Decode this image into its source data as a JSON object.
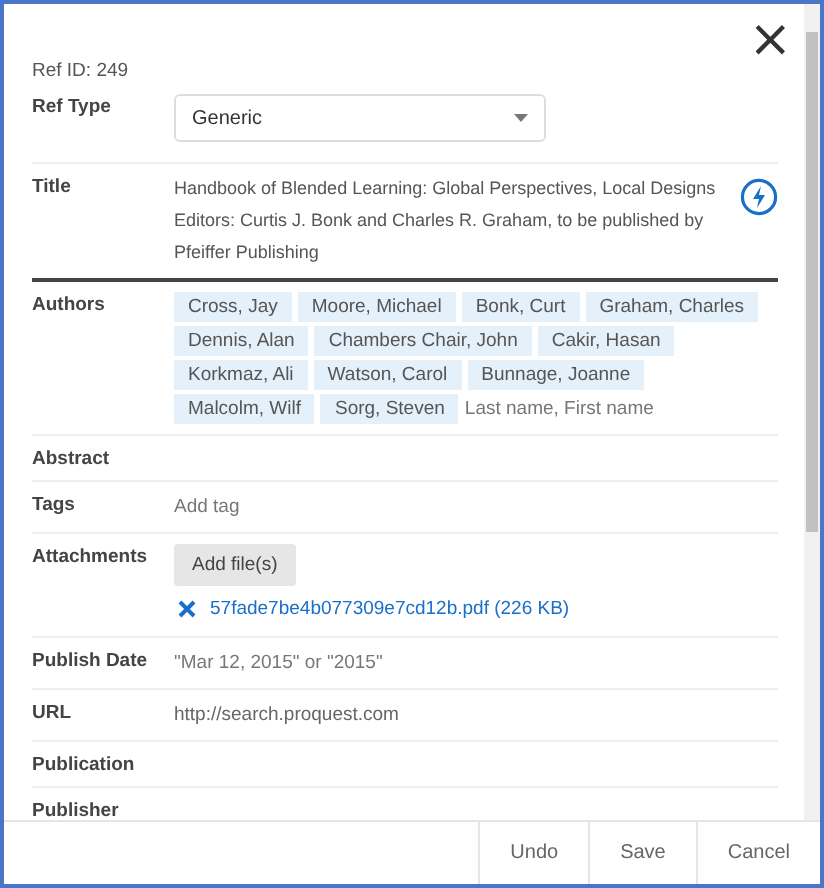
{
  "ref_id": "Ref ID: 249",
  "close": "×",
  "fields": [
    {
      "kind": "select",
      "label": "Ref Type",
      "value": "Generic"
    },
    {
      "kind": "text",
      "label": "Title",
      "lines": [
        "Handbook of Blended Learning: Global Perspectives, Local Designs",
        "Editors: Curtis J. Bonk and Charles R. Graham, to be published by",
        "Pfeiffer Publishing"
      ]
    },
    {
      "kind": "chips",
      "label": "Authors",
      "chips": [
        "Cross, Jay",
        "Moore, Michael",
        "Bonk, Curt",
        "Graham, Charles",
        "Dennis, Alan",
        "Chambers Chair, John",
        "Cakir, Hasan",
        "Korkmaz, Ali",
        "Watson, Carol",
        "Bunnage, Joanne",
        "Malcolm, Wilf",
        "Sorg, Steven"
      ],
      "placeholder": "Last name, First name"
    },
    {
      "kind": "empty",
      "label": "Abstract"
    },
    {
      "kind": "input",
      "label": "Tags",
      "placeholder": "Add tag"
    },
    {
      "kind": "attachments",
      "label": "Attachments",
      "button": "Add file(s)",
      "files": [
        "57fade7be4b077309e7cd12b.pdf (226 KB)"
      ]
    },
    {
      "kind": "input",
      "label": "Publish Date",
      "placeholder": "\"Mar 12, 2015\" or \"2015\""
    },
    {
      "kind": "input",
      "label": "URL",
      "value": "http://search.proquest.com"
    },
    {
      "kind": "empty",
      "label": "Publication"
    },
    {
      "kind": "empty",
      "label": "Publisher"
    }
  ],
  "footer_buttons": [
    "Undo",
    "Save",
    "Cancel"
  ]
}
